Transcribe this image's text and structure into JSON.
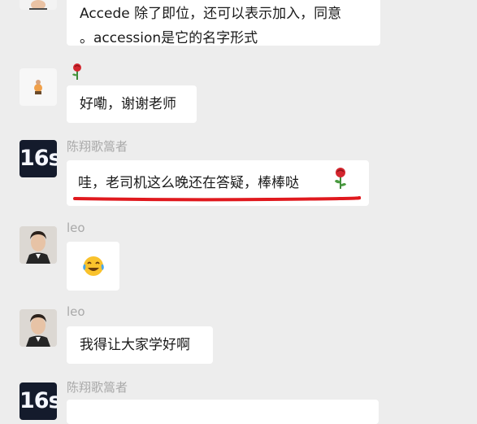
{
  "messages": {
    "m1": {
      "line1": "Accede 除了即位，还可以表示加入，同意",
      "line2": "。accession是它的名字形式"
    },
    "m2": {
      "emoji": "rose-emoji",
      "text": "好嘞，谢谢老师"
    },
    "m3": {
      "sender": "陈翔歌篙者",
      "avatar_text": "16s",
      "text": "哇，老司机这么晚还在答疑，棒棒哒",
      "emoji": "rose-emoji"
    },
    "m4": {
      "sender": "leo",
      "emoji": "tears-of-joy-emoji"
    },
    "m5": {
      "sender": "leo",
      "text": "我得让大家学好啊"
    },
    "m6": {
      "sender": "陈翔歌篙者",
      "avatar_text": "16s"
    }
  },
  "colors": {
    "background": "#ededed",
    "bubble": "#ffffff",
    "name": "#a9a9a9",
    "underline": "#e0191e"
  }
}
